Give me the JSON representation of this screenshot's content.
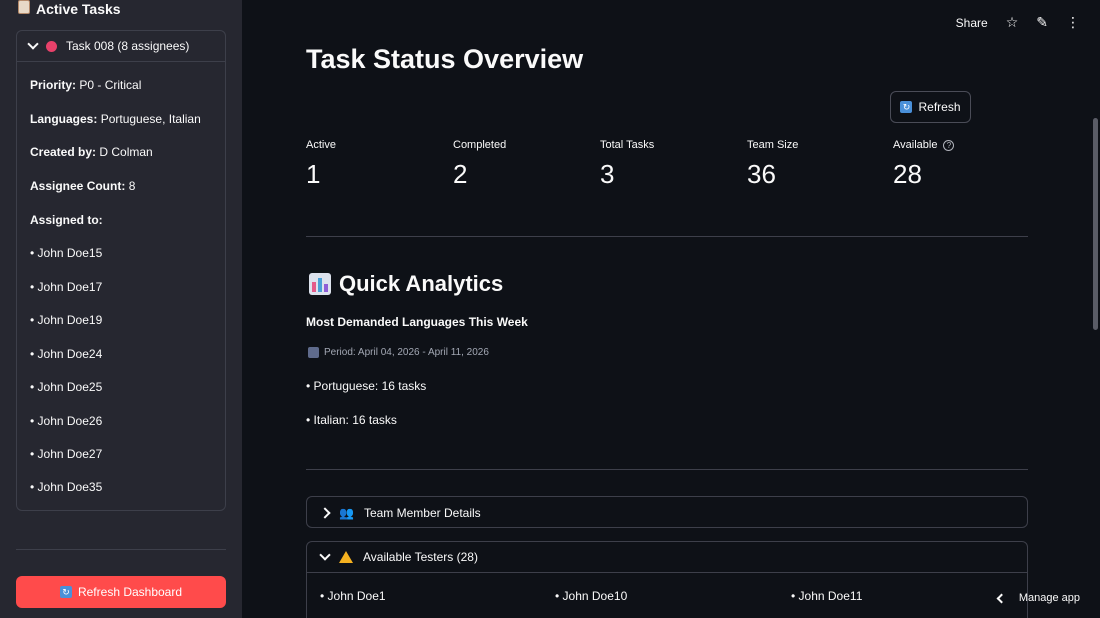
{
  "sidebar": {
    "header": "Active Tasks",
    "expander": {
      "title": "Task 008 (8 assignees)",
      "priority_label": "Priority:",
      "priority_value": "P0 - Critical",
      "languages_label": "Languages:",
      "languages_value": "Portuguese, Italian",
      "created_label": "Created by:",
      "created_value": "D Colman",
      "count_label": "Assignee Count:",
      "count_value": "8",
      "assigned_label": "Assigned to:",
      "assignees": [
        "• John Doe15",
        "• John Doe17",
        "• John Doe19",
        "• John Doe24",
        "• John Doe25",
        "• John Doe26",
        "• John Doe27",
        "• John Doe35"
      ]
    },
    "refresh_label": "Refresh Dashboard"
  },
  "toolbar": {
    "share_label": "Share"
  },
  "main": {
    "title": "Task Status Overview",
    "refresh_label": "Refresh",
    "metrics": [
      {
        "label": "Active",
        "value": "1"
      },
      {
        "label": "Completed",
        "value": "2"
      },
      {
        "label": "Total Tasks",
        "value": "3"
      },
      {
        "label": "Team Size",
        "value": "36"
      },
      {
        "label": "Available",
        "value": "28"
      }
    ],
    "analytics": {
      "title": "Quick Analytics",
      "subtitle": "Most Demanded Languages This Week",
      "period": "Period: April 04, 2026 - April 11, 2026",
      "items": [
        "• Portuguese: 16 tasks",
        "• Italian: 16 tasks"
      ]
    },
    "team_expander": {
      "title": "Team Member Details"
    },
    "testers_expander": {
      "title": "Available Testers (28)",
      "testers": [
        "• John Doe1",
        "• John Doe10",
        "• John Doe11"
      ]
    }
  },
  "footer": {
    "manage_label": "Manage app"
  }
}
